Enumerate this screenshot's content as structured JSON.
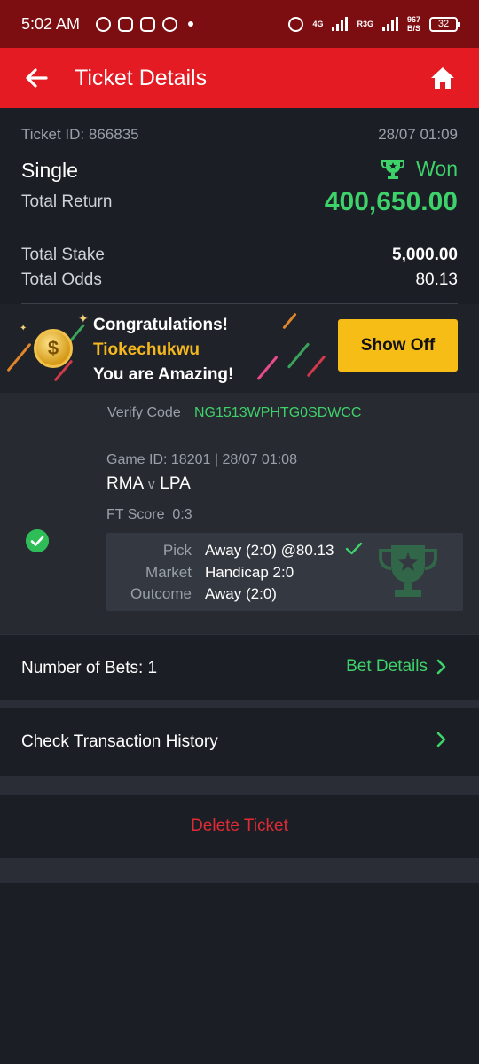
{
  "status_bar": {
    "time": "5:02 AM",
    "network_1": "4G",
    "network_2": "R3G",
    "speed_value": "967",
    "speed_unit": "B/S",
    "battery": "32"
  },
  "header": {
    "title": "Ticket Details",
    "back_icon": "arrow-left-icon",
    "home_icon": "home-icon"
  },
  "ticket": {
    "id": "Ticket ID: 866835",
    "date": "28/07 01:09",
    "type": "Single",
    "status": "Won",
    "total_return_label": "Total Return",
    "total_return": "400,650.00",
    "total_stake_label": "Total Stake",
    "total_stake": "5,000.00",
    "total_odds_label": "Total Odds",
    "total_odds": "80.13"
  },
  "banner": {
    "coin_symbol": "$",
    "line1": "Congratulations!",
    "username": "Tiokechukwu",
    "line3": "You are Amazing!",
    "button": "Show Off"
  },
  "verify": {
    "label": "Verify Code",
    "code": "NG1513WPHTG0SDWCC"
  },
  "game": {
    "info": "Game ID: 18201 | 28/07 01:08",
    "home": "RMA",
    "vs": "v",
    "away": "LPA",
    "ft_label": "FT Score",
    "ft_score": "0:3",
    "pick_label": "Pick",
    "pick": "Away (2:0) @80.13",
    "market_label": "Market",
    "market": "Handicap 2:0",
    "outcome_label": "Outcome",
    "outcome": "Away (2:0)"
  },
  "bets": {
    "label": "Number of Bets: 1",
    "details": "Bet Details"
  },
  "history": {
    "label": "Check Transaction History"
  },
  "delete": {
    "label": "Delete Ticket"
  },
  "colors": {
    "brand_red": "#e41b23",
    "win_green": "#3ed26a",
    "accent_yellow": "#f6bd16",
    "delete_red": "#e02b34"
  }
}
